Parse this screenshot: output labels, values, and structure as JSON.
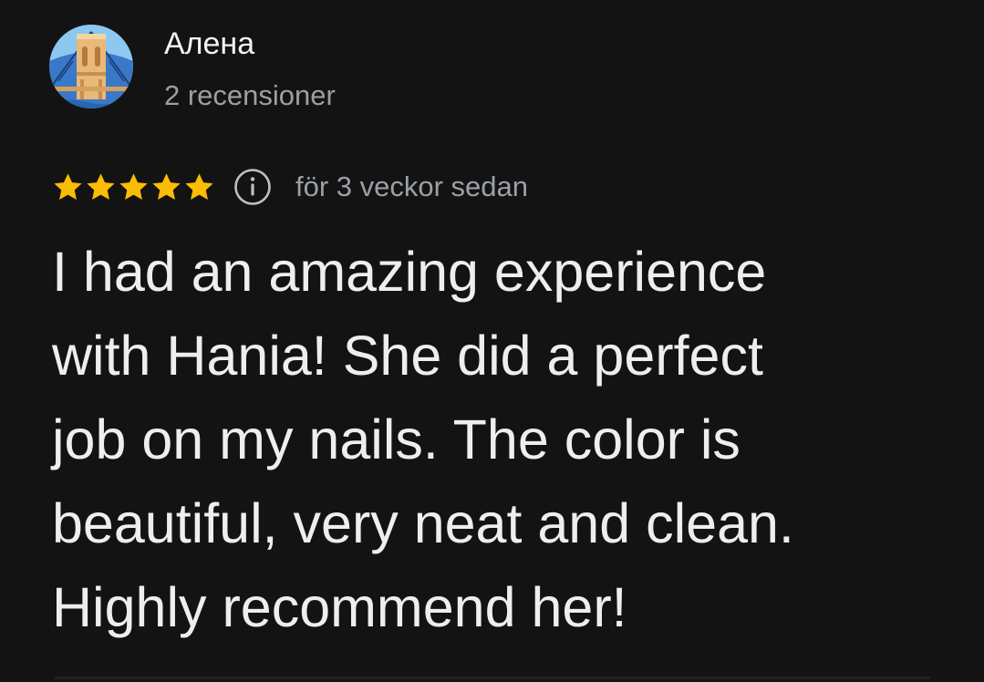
{
  "review": {
    "author": {
      "name": "Алена",
      "review_count": "2 recensioner",
      "avatar_icon": "bridge-avatar-icon"
    },
    "rating": {
      "stars": 5,
      "max": 5,
      "star_color": "#fbbc04",
      "icon": "star-icon"
    },
    "info_icon": "info-icon",
    "date": "för 3 veckor sedan",
    "text": "I had an amazing experience\nwith Hania! She did a perfect\njob on my nails. The color is\nbeautiful, very neat and clean.\nHighly recommend her!"
  },
  "colors": {
    "background": "#131313",
    "primary_text": "#eeeeee",
    "secondary_text": "#9aa0a6"
  }
}
